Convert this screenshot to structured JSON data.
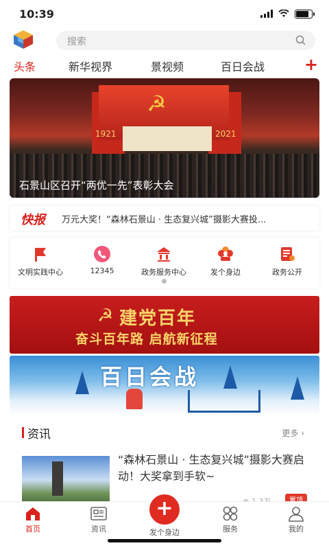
{
  "status": {
    "time": "10:39"
  },
  "search": {
    "placeholder": "搜索"
  },
  "tabs": [
    {
      "label": "头条",
      "active": true
    },
    {
      "label": "新华视界"
    },
    {
      "label": "景视频"
    },
    {
      "label": "百日会战"
    }
  ],
  "banner": {
    "caption": "石景山区召开“两优一先”表彰大会",
    "stage_years": [
      "1921",
      "2021"
    ]
  },
  "flash": {
    "tag": "快报",
    "text": "万元大奖！“森林石景山 · 生态复兴城”摄影大赛投..."
  },
  "quick_links": [
    {
      "label": "文明实践中心",
      "icon": "flag-icon"
    },
    {
      "label": "12345",
      "icon": "phone-icon"
    },
    {
      "label": "政务服务中心",
      "icon": "building-icon"
    },
    {
      "label": "发个身边",
      "icon": "flower-icon"
    },
    {
      "label": "政务公开",
      "icon": "document-icon"
    }
  ],
  "promo_party": {
    "title": "建党百年",
    "subtitle": "奋斗百年路 启航新征程"
  },
  "promo_battle": {
    "title": "百日会战"
  },
  "news_section": {
    "heading": "资讯",
    "more": "更多",
    "item": {
      "title": "“森林石景山 · 生态复兴城”摄影大赛启动！大奖拿到手软~",
      "views": "1.3万",
      "badge": "置顶"
    }
  },
  "tabbar": [
    {
      "label": "首页",
      "icon": "home-icon",
      "active": true
    },
    {
      "label": "资讯",
      "icon": "news-icon"
    },
    {
      "label": "发个身边",
      "icon": "plus-icon"
    },
    {
      "label": "服务",
      "icon": "grid-icon"
    },
    {
      "label": "我的",
      "icon": "person-icon"
    }
  ],
  "colors": {
    "accent": "#d9221c"
  }
}
